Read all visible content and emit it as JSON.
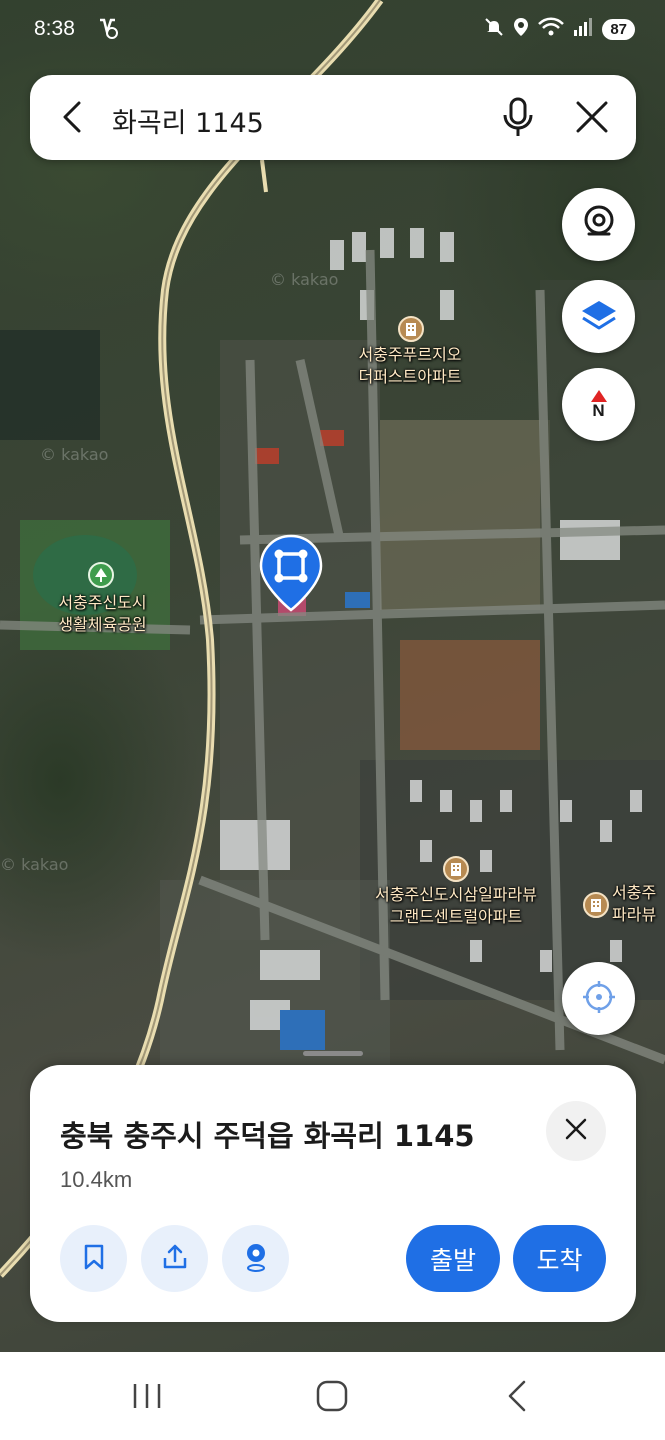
{
  "status_bar": {
    "time": "8:38",
    "battery": "87",
    "icons": [
      "notification-off-icon",
      "location-icon",
      "wifi-icon",
      "signal-icon"
    ]
  },
  "search": {
    "query": "화곡리 1145",
    "icons": [
      "back-arrow-icon",
      "microphone-icon",
      "close-icon"
    ]
  },
  "map": {
    "view": "satellite",
    "watermark": "© kakao",
    "controls": [
      "roadview-icon",
      "layers-icon",
      "compass-icon",
      "current-location-icon"
    ],
    "compass_label": "N",
    "pois": [
      {
        "type": "apartment",
        "lines": [
          "서충주푸르지오",
          "더퍼스트아파트"
        ]
      },
      {
        "type": "park",
        "lines": [
          "서충주신도시",
          "생활체육공원"
        ]
      },
      {
        "type": "apartment",
        "lines": [
          "서충주신도시삼일파라뷰",
          "그랜드센트럴아파트"
        ]
      },
      {
        "type": "apartment",
        "lines": [
          "서충주",
          "파라뷰"
        ]
      }
    ],
    "accent_color": "#1f6fe5"
  },
  "sheet": {
    "title": "충북 충주시 주덕읍 화곡리 1145",
    "distance": "10.4km",
    "actions": [
      "bookmark-icon",
      "share-icon",
      "pin-icon"
    ],
    "depart_label": "출발",
    "arrive_label": "도착"
  },
  "nav_bar": {
    "buttons": [
      "recent-apps-icon",
      "home-icon",
      "back-icon"
    ]
  }
}
